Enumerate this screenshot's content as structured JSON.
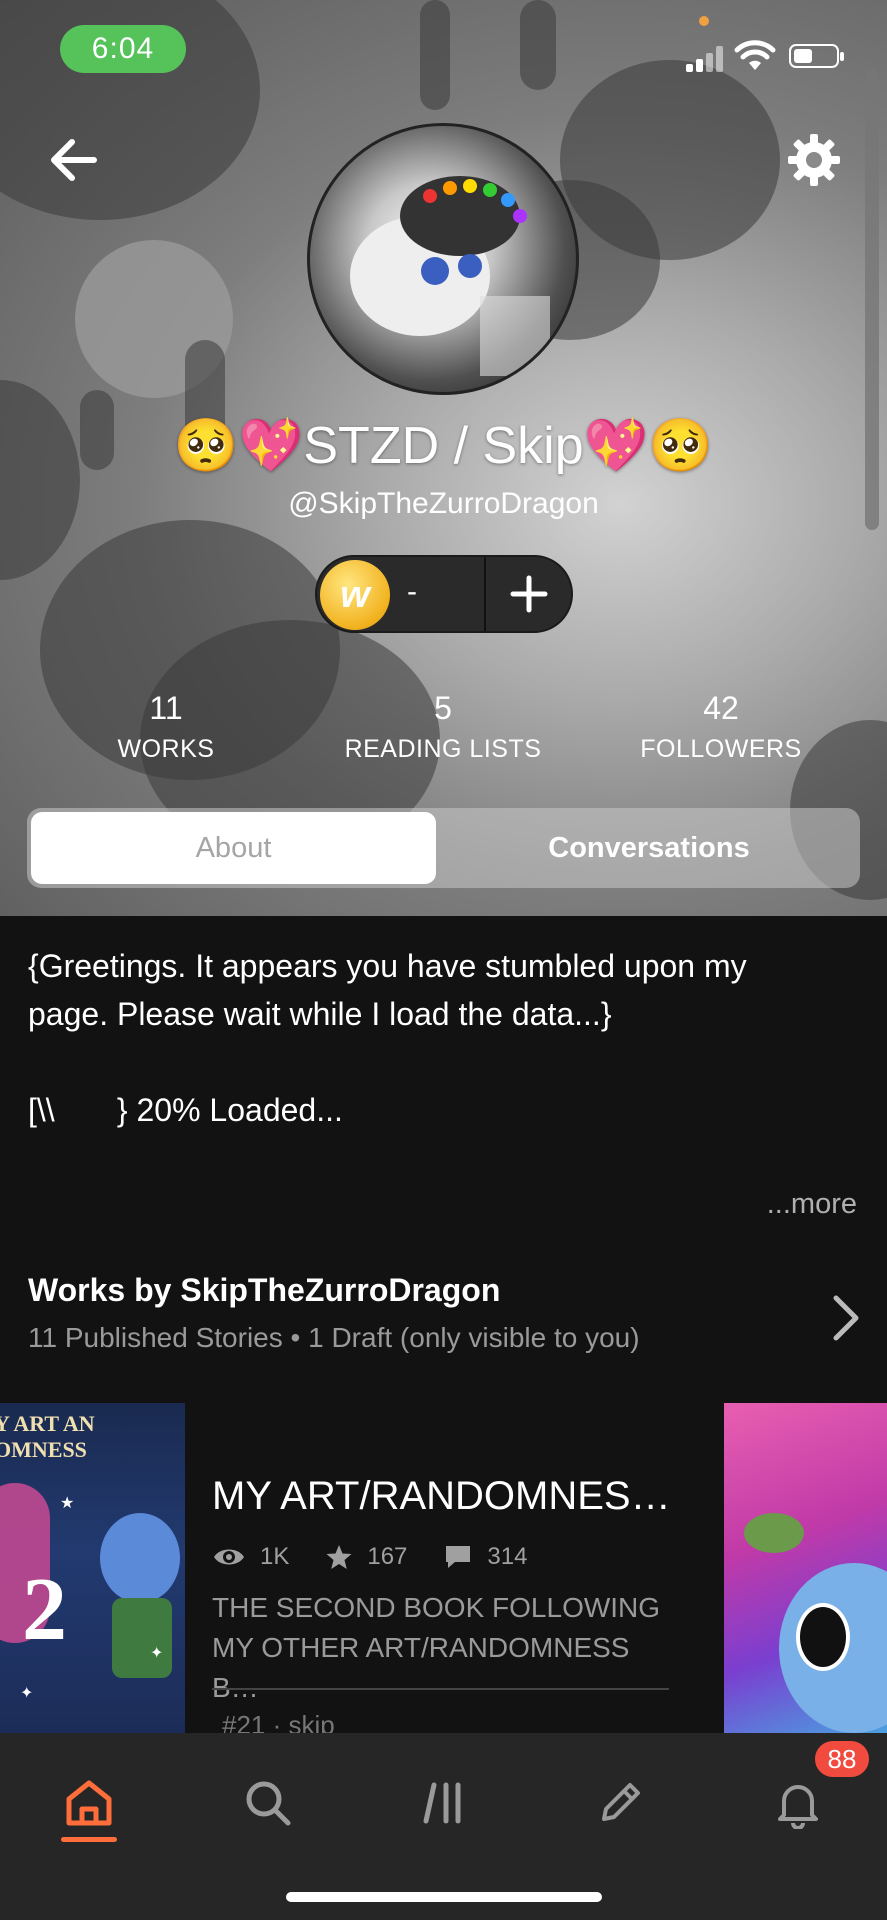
{
  "status_bar": {
    "time": "6:04"
  },
  "profile": {
    "display_name": "🥺💖STZD / Skip💖🥺",
    "handle": "@SkipTheZurroDragon",
    "coins": "-"
  },
  "stats": [
    {
      "value": "11",
      "label": "WORKS"
    },
    {
      "value": "5",
      "label": "READING LISTS"
    },
    {
      "value": "42",
      "label": "FOLLOWERS"
    }
  ],
  "tabs": {
    "about": "About",
    "conversations": "Conversations"
  },
  "about": {
    "lines": [
      "{Greetings. It appears you have stumbled upon my",
      "page. Please wait while I load the data...}",
      "",
      "[\\\\       } 20% Loaded..."
    ],
    "more": "...more"
  },
  "works": {
    "title": "Works by SkipTheZurroDragon",
    "subtitle": "11 Published Stories • 1 Draft (only visible to you)"
  },
  "story": {
    "title": "MY ART/RANDOMNES…",
    "views": "1K",
    "votes": "167",
    "comments": "314",
    "description": [
      "THE SECOND BOOK FOLLOWING",
      "MY OTHER ART/RANDOMNESS B…"
    ],
    "tag": "#21 · skip",
    "cover_text": [
      "Y ART AN",
      "OMNESS"
    ],
    "cover_number": "2"
  },
  "tabbar": {
    "notification_count": "88",
    "items": [
      "home-icon",
      "search-icon",
      "library-icon",
      "write-icon",
      "notifications-icon"
    ],
    "active_color": "#ff6d3a"
  },
  "colors": {
    "background": "#121212",
    "tabbar": "#262626",
    "badge": "#f14b3f",
    "status_pill": "#55c35a"
  }
}
